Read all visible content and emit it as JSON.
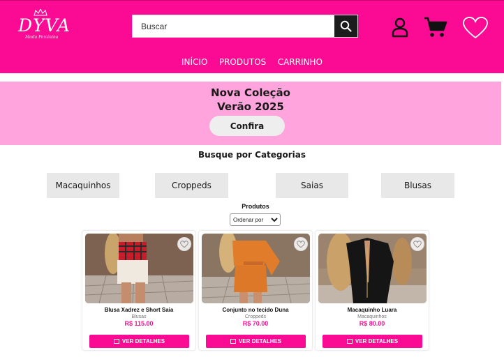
{
  "colors": {
    "brand_pink": "#fb0b94",
    "hero_pink": "#ffa4dc",
    "category_bg": "#e8e8e8"
  },
  "header": {
    "logo_text": "DYVA",
    "logo_tagline": "Moda Feminina",
    "search": {
      "placeholder": "Buscar",
      "value": ""
    },
    "icons": [
      "search-icon",
      "user-icon",
      "cart-icon",
      "heart-icon"
    ]
  },
  "nav": {
    "items": [
      {
        "label": "INÍCIO"
      },
      {
        "label": "PRODUTOS"
      },
      {
        "label": "CARRINHO"
      }
    ]
  },
  "hero": {
    "line1": "Nova Coleção",
    "line2": "Verão 2025",
    "cta": "Confira"
  },
  "categories": {
    "title": "Busque por Categorias",
    "items": [
      {
        "label": "Macaquinhos"
      },
      {
        "label": "Croppeds"
      },
      {
        "label": "Saias"
      },
      {
        "label": "Blusas"
      }
    ]
  },
  "products": {
    "title": "Produtos",
    "sort": {
      "selected": "Ordenar por"
    },
    "items": [
      {
        "name": "Blusa Xadrez e Short Saia",
        "category": "Blusas",
        "price": "R$ 115.00",
        "button": "VER DETALHES"
      },
      {
        "name": "Conjunto no tecido Duna",
        "category": "Croppeds",
        "price": "R$ 70.00",
        "button": "VER DETALHES"
      },
      {
        "name": "Macaquinho Luara",
        "category": "Macaquinhos",
        "price": "R$ 80.00",
        "button": "VER DETALHES"
      }
    ]
  }
}
